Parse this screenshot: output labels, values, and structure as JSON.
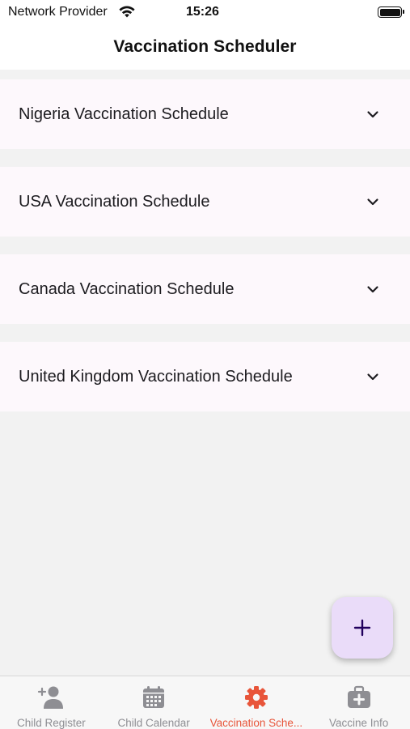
{
  "status_bar": {
    "carrier": "Network Provider",
    "time": "15:26",
    "wifi_icon": "wifi-icon",
    "battery_icon": "battery-icon"
  },
  "header": {
    "title": "Vaccination Scheduler"
  },
  "schedules": [
    {
      "label": "Nigeria Vaccination Schedule",
      "icon": "chevron-down-icon"
    },
    {
      "label": "USA Vaccination Schedule",
      "icon": "chevron-down-icon"
    },
    {
      "label": "Canada Vaccination Schedule",
      "icon": "chevron-down-icon"
    },
    {
      "label": "United Kingdom Vaccination Schedule",
      "icon": "chevron-down-icon"
    }
  ],
  "fab": {
    "icon": "plus-icon"
  },
  "tabs": [
    {
      "label": "Child Register",
      "icon": "person-add-icon",
      "active": false
    },
    {
      "label": "Child Calendar",
      "icon": "calendar-icon",
      "active": false
    },
    {
      "label": "Vaccination Sche...",
      "icon": "gear-icon",
      "active": true
    },
    {
      "label": "Vaccine Info",
      "icon": "medical-kit-icon",
      "active": false
    }
  ],
  "colors": {
    "accent": "#e8553a",
    "inactive": "#8e8e93",
    "fab_background": "#eadcf9",
    "card_background": "#fdf8fc",
    "page_background": "#f2f2f2"
  }
}
